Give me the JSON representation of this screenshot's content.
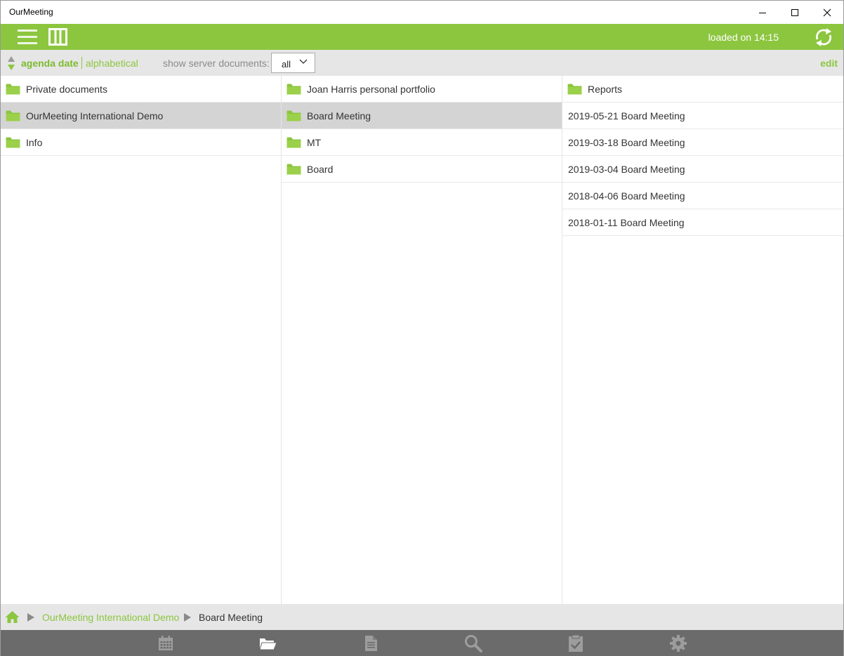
{
  "window": {
    "title": "OurMeeting"
  },
  "appbar": {
    "loaded_text": "loaded on 14:15",
    "accent": "#8cc63f"
  },
  "toolbar": {
    "sort_primary": "agenda date",
    "sort_secondary": "alphabetical",
    "server_label": "show server documents:",
    "server_value": "all",
    "edit_label": "edit"
  },
  "panes": {
    "col1": [
      {
        "label": "Private documents",
        "icon": "folder-icon",
        "selected": false
      },
      {
        "label": "OurMeeting International Demo",
        "icon": "folder-icon",
        "selected": true
      },
      {
        "label": "Info",
        "icon": "folder-icon",
        "selected": false
      }
    ],
    "col2": [
      {
        "label": "Joan Harris personal portfolio",
        "icon": "folder-icon",
        "selected": false
      },
      {
        "label": "Board Meeting",
        "icon": "folder-icon",
        "selected": true
      },
      {
        "label": "MT",
        "icon": "folder-icon",
        "selected": false
      },
      {
        "label": "Board",
        "icon": "folder-icon",
        "selected": false
      }
    ],
    "col3": [
      {
        "label": "Reports",
        "icon": "folder-icon",
        "selected": false
      },
      {
        "label": "2019-05-21 Board Meeting",
        "icon": "",
        "selected": false
      },
      {
        "label": "2019-03-18 Board Meeting",
        "icon": "",
        "selected": false
      },
      {
        "label": "2019-03-04 Board Meeting",
        "icon": "",
        "selected": false
      },
      {
        "label": "2018-04-06 Board Meeting",
        "icon": "",
        "selected": false
      },
      {
        "label": "2018-01-11 Board Meeting",
        "icon": "",
        "selected": false
      }
    ]
  },
  "breadcrumb": {
    "items": [
      "OurMeeting International Demo",
      "Board Meeting"
    ]
  },
  "bottomnav": {
    "items": [
      {
        "icon": "calendar-icon",
        "active": false
      },
      {
        "icon": "folder-open-icon",
        "active": true
      },
      {
        "icon": "document-icon",
        "active": false
      },
      {
        "icon": "search-icon",
        "active": false
      },
      {
        "icon": "clipboard-check-icon",
        "active": false
      },
      {
        "icon": "gear-icon",
        "active": false
      }
    ]
  }
}
